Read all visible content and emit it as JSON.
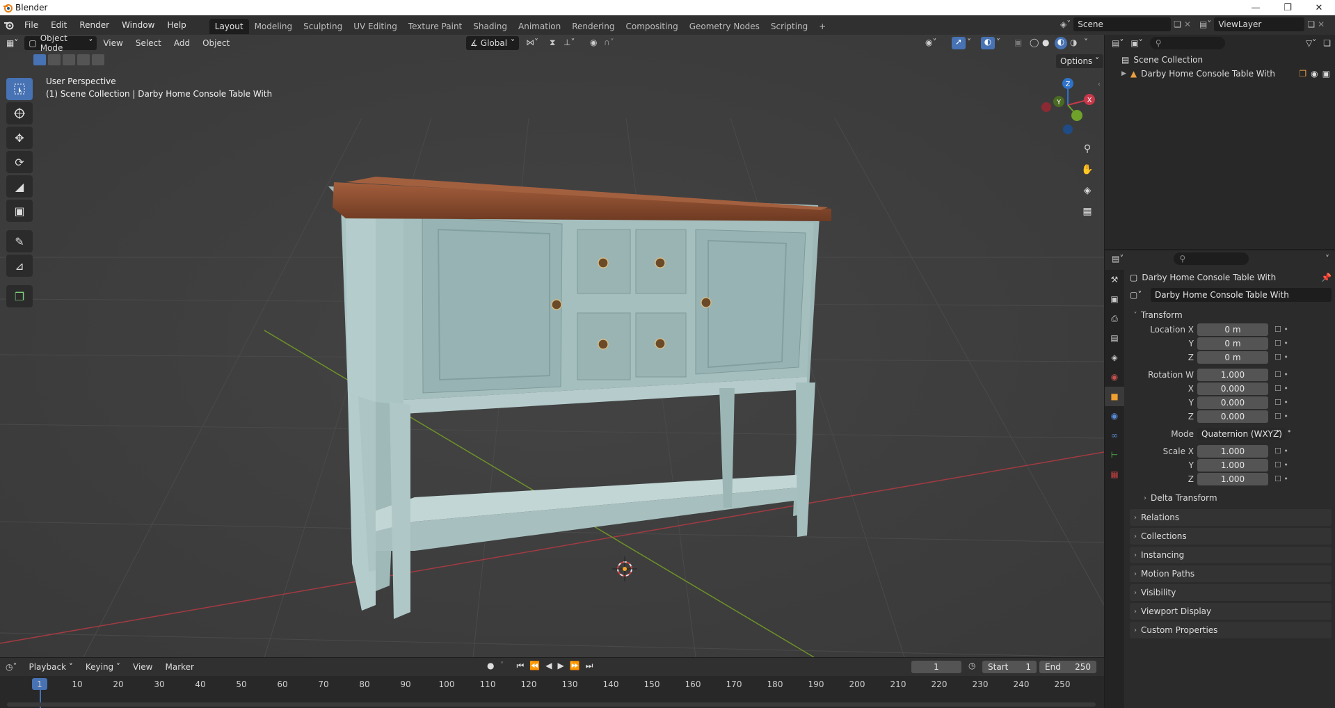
{
  "window": {
    "title": "Blender"
  },
  "menus": [
    "File",
    "Edit",
    "Render",
    "Window",
    "Help"
  ],
  "workspaces": [
    "Layout",
    "Modeling",
    "Sculpting",
    "UV Editing",
    "Texture Paint",
    "Shading",
    "Animation",
    "Rendering",
    "Compositing",
    "Geometry Nodes",
    "Scripting"
  ],
  "active_workspace": "Layout",
  "scene": {
    "name": "Scene",
    "view_layer": "ViewLayer"
  },
  "viewport": {
    "mode": "Object Mode",
    "menus": [
      "View",
      "Select",
      "Add",
      "Object"
    ],
    "orientation": "Global",
    "options_label": "Options",
    "overlay_line1": "User Perspective",
    "overlay_line2": "(1) Scene Collection | Darby Home Console Table With",
    "gizmo": {
      "x": "X",
      "y": "Y",
      "z": "Z"
    }
  },
  "outliner": {
    "root": "Scene Collection",
    "items": [
      {
        "name": "Darby Home Console Table With"
      }
    ]
  },
  "properties": {
    "object_name": "Darby Home Console Table With",
    "data_name": "Darby Home Console Table With",
    "transform_title": "Transform",
    "location": {
      "label_x": "Location X",
      "label_y": "Y",
      "label_z": "Z",
      "x": "0 m",
      "y": "0 m",
      "z": "0 m"
    },
    "rotation": {
      "label_w": "Rotation W",
      "label_x": "X",
      "label_y": "Y",
      "label_z": "Z",
      "w": "1.000",
      "x": "0.000",
      "y": "0.000",
      "z": "0.000"
    },
    "mode_label": "Mode",
    "mode_value": "Quaternion (WXYZ)",
    "scale": {
      "label_x": "Scale X",
      "label_y": "Y",
      "label_z": "Z",
      "x": "1.000",
      "y": "1.000",
      "z": "1.000"
    },
    "delta": "Delta Transform",
    "sections": [
      "Relations",
      "Collections",
      "Instancing",
      "Motion Paths",
      "Visibility",
      "Viewport Display",
      "Custom Properties"
    ]
  },
  "timeline": {
    "menus": [
      "Playback",
      "Keying",
      "View",
      "Marker"
    ],
    "current_frame": "1",
    "start_label": "Start",
    "start": "1",
    "end_label": "End",
    "end": "250",
    "ticks": [
      "1",
      "10",
      "20",
      "30",
      "40",
      "50",
      "60",
      "70",
      "80",
      "90",
      "100",
      "110",
      "120",
      "130",
      "140",
      "150",
      "160",
      "170",
      "180",
      "190",
      "200",
      "210",
      "220",
      "230",
      "240",
      "250"
    ]
  },
  "colors": {
    "accent": "#4772b3",
    "x_axis": "#c7394a",
    "y_axis": "#6ea22a",
    "z_axis": "#2e72c9",
    "table_body": "#a3bcbc",
    "table_top": "#8a4a2c"
  }
}
